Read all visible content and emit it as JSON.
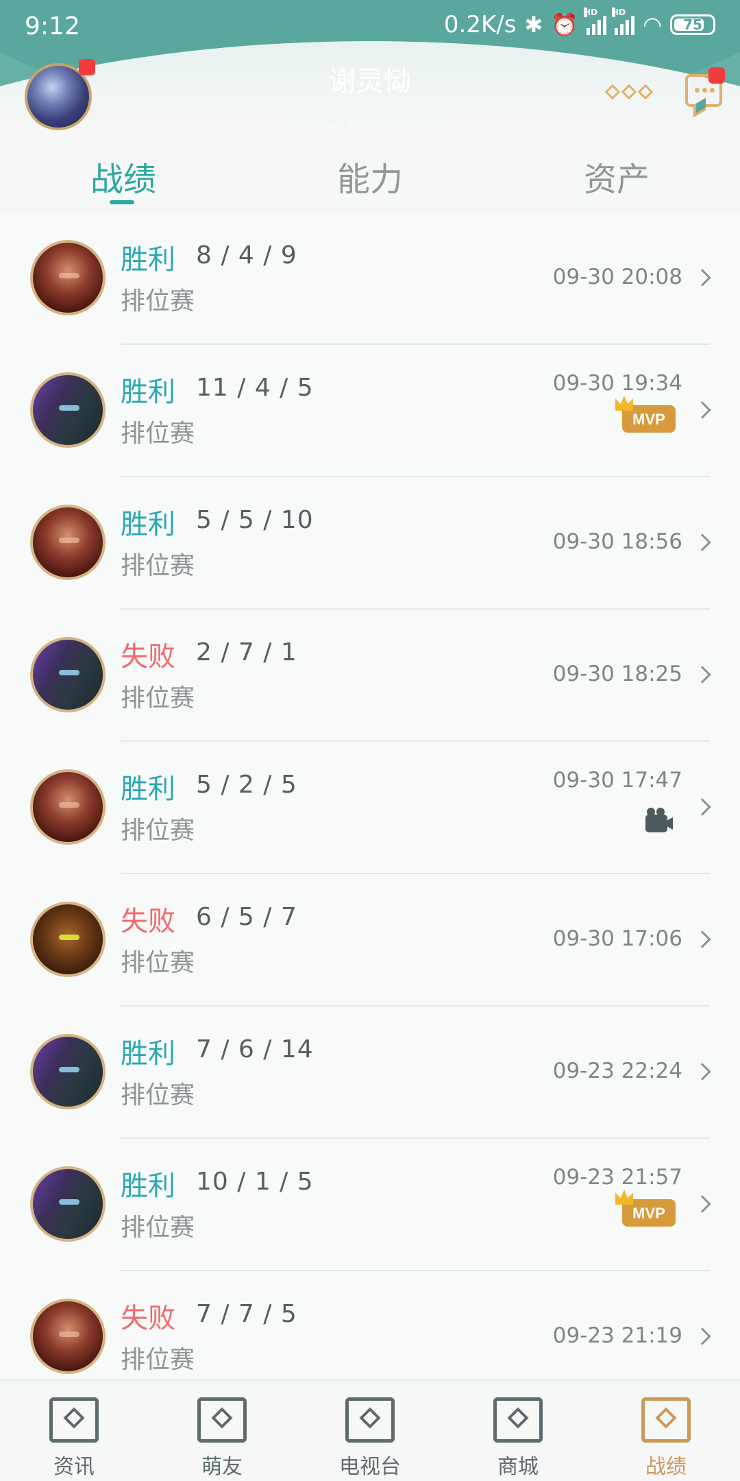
{
  "status_bar": {
    "time": "9:12",
    "net_speed": "0.2K/s",
    "battery": "75",
    "icons": [
      "bluetooth-icon",
      "alarm-icon",
      "signal-hd-icon",
      "signal-hd-icon",
      "wifi-icon",
      "battery-icon"
    ]
  },
  "profile": {
    "name": "谢灵恸",
    "level_info": "Lv54 | 比尔吉沃特"
  },
  "tabs": [
    {
      "label": "战绩",
      "active": true
    },
    {
      "label": "能力",
      "active": false
    },
    {
      "label": "资产",
      "active": false
    }
  ],
  "matches": [
    {
      "result": "胜利",
      "kda": "8 / 4 / 9",
      "mode": "排位赛",
      "time": "09-30 20:08",
      "hero": "darius",
      "badge": ""
    },
    {
      "result": "胜利",
      "kda": "11 / 4 / 5",
      "mode": "排位赛",
      "time": "09-30 19:34",
      "hero": "sion",
      "badge": "MVP"
    },
    {
      "result": "胜利",
      "kda": "5 / 5 / 10",
      "mode": "排位赛",
      "time": "09-30 18:56",
      "hero": "darius",
      "badge": ""
    },
    {
      "result": "失败",
      "kda": "2 / 7 / 1",
      "mode": "排位赛",
      "time": "09-30 18:25",
      "hero": "sion",
      "badge": ""
    },
    {
      "result": "胜利",
      "kda": "5 / 2 / 5",
      "mode": "排位赛",
      "time": "09-30 17:47",
      "hero": "darius",
      "badge": "video"
    },
    {
      "result": "失败",
      "kda": "6 / 5 / 7",
      "mode": "排位赛",
      "time": "09-30 17:06",
      "hero": "rengar",
      "badge": ""
    },
    {
      "result": "胜利",
      "kda": "7 / 6 / 14",
      "mode": "排位赛",
      "time": "09-23 22:24",
      "hero": "sion",
      "badge": ""
    },
    {
      "result": "胜利",
      "kda": "10 / 1 / 5",
      "mode": "排位赛",
      "time": "09-23 21:57",
      "hero": "sion",
      "badge": "MVP"
    },
    {
      "result": "失败",
      "kda": "7 / 7 / 5",
      "mode": "排位赛",
      "time": "09-23 21:19",
      "hero": "darius",
      "badge": ""
    }
  ],
  "colors": {
    "accent": "#2aa89e",
    "win": "#28a8b4",
    "loss": "#ef6b6b",
    "gold": "#c99a5b",
    "header": "#5aa79d"
  },
  "bottom_nav": [
    {
      "label": "资讯",
      "icon": "news-icon",
      "active": false
    },
    {
      "label": "萌友",
      "icon": "friends-icon",
      "active": false
    },
    {
      "label": "电视台",
      "icon": "tv-icon",
      "active": false
    },
    {
      "label": "商城",
      "icon": "shop-icon",
      "active": false
    },
    {
      "label": "战绩",
      "icon": "record-icon",
      "active": true
    }
  ]
}
